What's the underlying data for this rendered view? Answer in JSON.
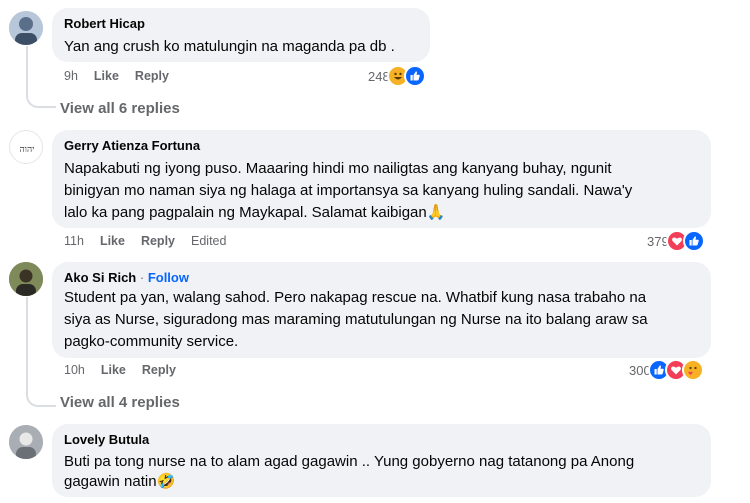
{
  "comments": [
    {
      "author": "Robert Hicap",
      "lines": [
        "Yan ang crush ko matulungin na maganda pa db ."
      ],
      "time": "9h",
      "like": "Like",
      "reply": "Reply",
      "reaction_count": "248",
      "reactions": [
        "haha",
        "like"
      ],
      "view_replies": "View all 6 replies"
    },
    {
      "author": "Gerry Atienza Fortuna",
      "lines": [
        "Napakabuti ng iyong puso. Maaaring hindi mo nailigtas ang kanyang buhay, ngunit",
        "binigyan mo naman siya ng halaga at importansya sa kanyang huling sandali. Nawa'y",
        "lalo ka pang pagpalain ng Maykapal. Salamat kaibigan🙏"
      ],
      "time": "11h",
      "like": "Like",
      "reply": "Reply",
      "edited": "Edited",
      "reaction_count": "379",
      "reactions": [
        "love",
        "like"
      ]
    },
    {
      "author": "Ako Si Rich",
      "follow_sep": " · ",
      "follow": "Follow",
      "lines": [
        "Student pa yan, walang sahod. Pero nakapag rescue na. Whatbif kung nasa trabaho na",
        "siya as Nurse, siguradong mas maraming matutulungan ng Nurse na ito balang araw sa",
        "pagko-community service."
      ],
      "time": "10h",
      "like": "Like",
      "reply": "Reply",
      "reaction_count": "300",
      "reactions": [
        "like",
        "love",
        "care"
      ],
      "view_replies": "View all 4 replies"
    },
    {
      "author": "Lovely Butula",
      "lines": [
        "Buti pa tong nurse na to alam agad gagawin .. Yung gobyerno nag tatanong pa Anong",
        "gagawin natin🤣"
      ]
    }
  ],
  "colors": {
    "like": "#0866ff",
    "love": "#f33e58",
    "haha": "#f7b125",
    "care": "#f7b125"
  }
}
